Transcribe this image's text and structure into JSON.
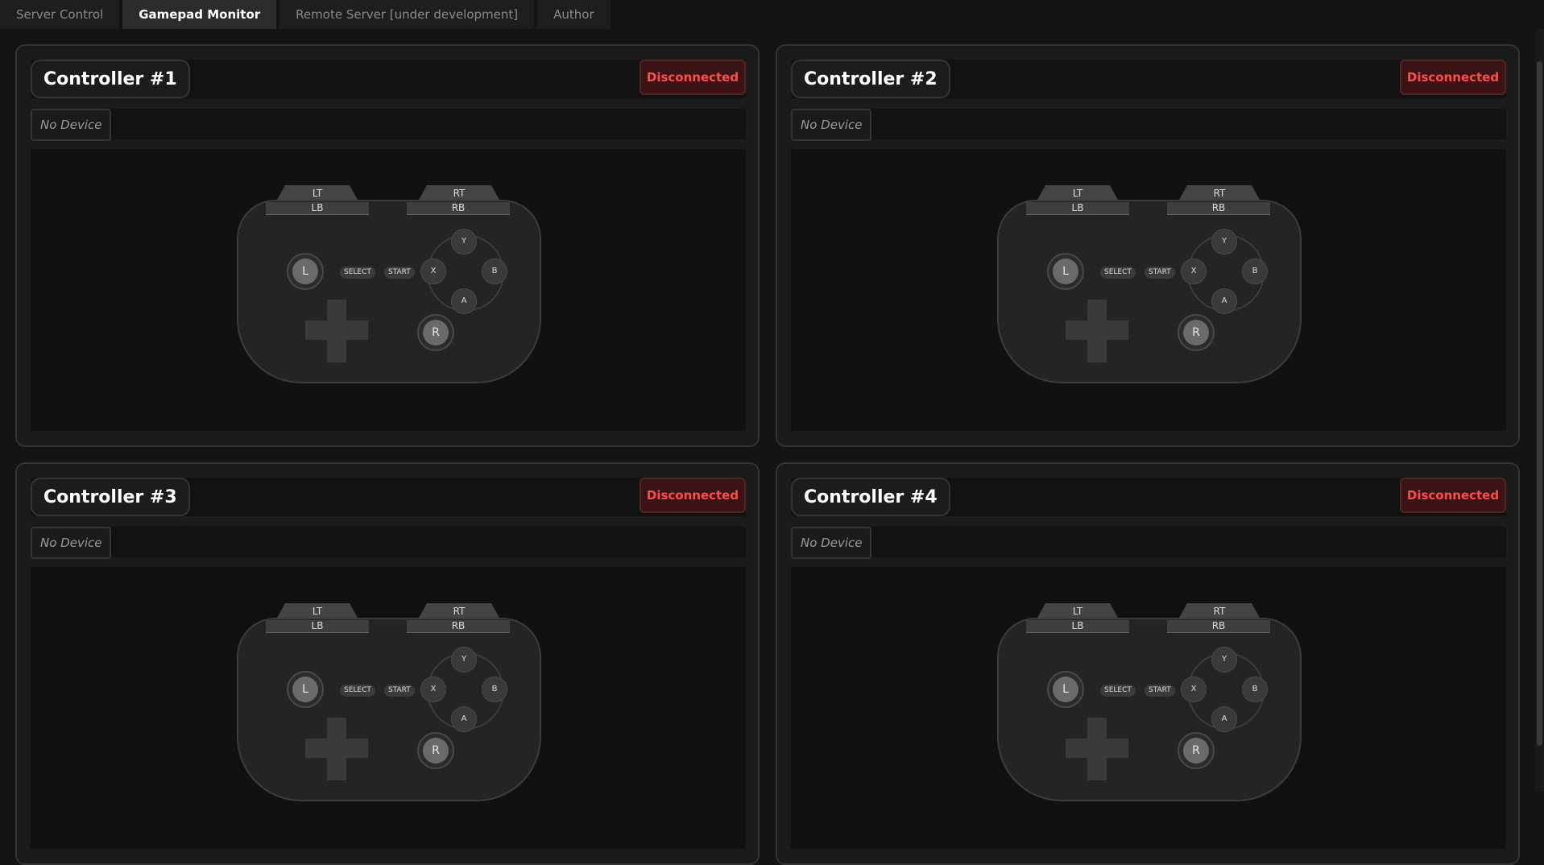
{
  "tabs": [
    {
      "label": "Server Control",
      "active": false
    },
    {
      "label": "Gamepad Monitor",
      "active": true
    },
    {
      "label": "Remote Server [under development]",
      "active": false
    },
    {
      "label": "Author",
      "active": false
    }
  ],
  "controllers": [
    {
      "title": "Controller #1",
      "status": "Disconnected",
      "device": "No Device"
    },
    {
      "title": "Controller #2",
      "status": "Disconnected",
      "device": "No Device"
    },
    {
      "title": "Controller #3",
      "status": "Disconnected",
      "device": "No Device"
    },
    {
      "title": "Controller #4",
      "status": "Disconnected",
      "device": "No Device"
    }
  ],
  "gamepad": {
    "lt": "LT",
    "rt": "RT",
    "lb": "LB",
    "rb": "RB",
    "left_stick": "L",
    "right_stick": "R",
    "select": "SELECT",
    "start": "START",
    "y": "Y",
    "x": "X",
    "b": "B",
    "a": "A"
  },
  "colors": {
    "status_text": "#ff4d4d",
    "status_bg": "#3a1414",
    "background": "#141414"
  }
}
